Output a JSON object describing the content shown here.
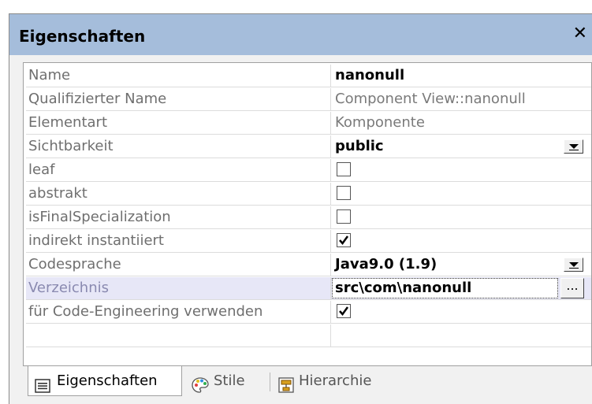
{
  "panel": {
    "title": "Eigenschaften",
    "close_label": "✕"
  },
  "properties": [
    {
      "name": "Name",
      "value": "nanonull",
      "kind": "text-bold"
    },
    {
      "name": "Qualifizierter Name",
      "value": "Component View::nanonull",
      "kind": "text-gray"
    },
    {
      "name": "Elementart",
      "value": "Komponente",
      "kind": "text-gray"
    },
    {
      "name": "Sichtbarkeit",
      "value": "public",
      "kind": "dropdown"
    },
    {
      "name": "leaf",
      "checked": false,
      "kind": "checkbox"
    },
    {
      "name": "abstrakt",
      "checked": false,
      "kind": "checkbox"
    },
    {
      "name": "isFinalSpecialization",
      "checked": false,
      "kind": "checkbox"
    },
    {
      "name": "indirekt instantiiert",
      "checked": true,
      "kind": "checkbox"
    },
    {
      "name": "Codesprache",
      "value": "Java9.0 (1.9)",
      "kind": "dropdown"
    },
    {
      "name": "Verzeichnis",
      "value": "src\\com\\nanonull",
      "kind": "edit"
    },
    {
      "name": "für Code-Engineering verwenden",
      "checked": true,
      "kind": "checkbox"
    }
  ],
  "ellipsis_label": "...",
  "tabs": [
    {
      "label": "Eigenschaften",
      "active": true,
      "icon": "properties-list-icon"
    },
    {
      "label": "Stile",
      "active": false,
      "icon": "palette-icon"
    },
    {
      "label": "Hierarchie",
      "active": false,
      "icon": "hierarchy-icon"
    }
  ],
  "colors": {
    "titlebar": "#a5bddb",
    "selected_row": "#e7e7f7",
    "edit_box": "#ffffff"
  }
}
